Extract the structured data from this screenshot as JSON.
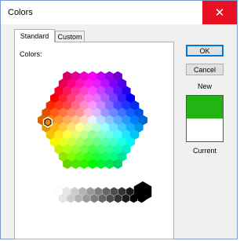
{
  "window": {
    "title": "Colors",
    "close_glyph": "✕"
  },
  "tabs": [
    {
      "label": "Standard"
    },
    {
      "label": "Custom"
    }
  ],
  "panel": {
    "colors_label": "Colors:"
  },
  "buttons": {
    "ok": "OK",
    "cancel": "Cancel"
  },
  "preview": {
    "new_label": "New",
    "current_label": "Current",
    "new_color": "#22b412",
    "current_color": "#ffffff"
  }
}
